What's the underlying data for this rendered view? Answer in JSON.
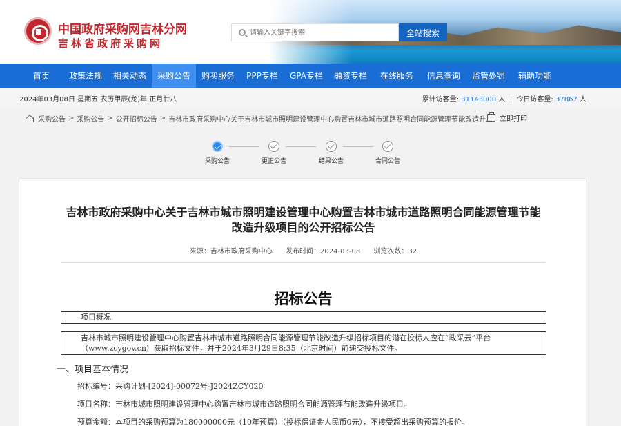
{
  "header": {
    "title": "中国政府采购网吉林分网",
    "subtitle": "吉林省政府采购网",
    "search_placeholder": "请输入关键字搜索",
    "search_button": "全站搜索"
  },
  "nav": [
    {
      "label": "首页",
      "active": false
    },
    {
      "label": "政策法规",
      "active": false
    },
    {
      "label": "相关动态",
      "active": false
    },
    {
      "label": "采购公告",
      "active": true
    },
    {
      "label": "购买服务",
      "active": false
    },
    {
      "label": "PPP专栏",
      "active": false
    },
    {
      "label": "GPA专栏",
      "active": false
    },
    {
      "label": "融资专栏",
      "active": false
    },
    {
      "label": "在线服务",
      "active": false
    },
    {
      "label": "信息查询",
      "active": false
    },
    {
      "label": "监管处罚",
      "active": false
    },
    {
      "label": "辅助功能",
      "active": false
    }
  ],
  "info_bar": {
    "date": "2024年03月08日 星期五 农历甲辰(龙)年 正月廿八",
    "total_visits_label": "累计访客量:",
    "total_visits": "31143000",
    "total_visits_unit": "人",
    "today_visits_label": "今日访客量:",
    "today_visits": "37867",
    "today_visits_unit": "人"
  },
  "breadcrumb": {
    "items": [
      "采购公告",
      "采购公告",
      "公开招标公告",
      "吉林市政府采购中心关于吉林市城市照明建设管理中心购置吉林市城市道路照明合同能源管理节能改造升..."
    ],
    "separator": ">"
  },
  "print_label": "立即打印",
  "steps": [
    {
      "label": "采购公告",
      "done": true
    },
    {
      "label": "更正公告",
      "done": false
    },
    {
      "label": "结果公告",
      "done": false
    },
    {
      "label": "合同公告",
      "done": false
    }
  ],
  "article": {
    "title": "吉林市政府采购中心关于吉林市城市照明建设管理中心购置吉林市城市道路照明合同能源管理节能改造升级项目的公开招标公告",
    "source": "来源：吉林市政府采购中心",
    "publish_time": "发布时间：2024-03-08",
    "views": "浏览次数：32",
    "notice_title": "招标公告",
    "overview_label": "项目概况",
    "overview_text": "吉林市城市照明建设管理中心购置吉林市城市道路照明合同能源管理节能改造升级招标项目的潜在投标人应在“政采云”平台（www.zcygov.cn）获取招标文件，并于2024年3月29日8:35（北京时间）前递交投标文件。",
    "section_1": "一、项目基本情况",
    "field_bid_no": "招标编号：采购计划-[2024]-00072号-J2024ZCY020",
    "field_project_name": "项目名称：吉林市城市照明建设管理中心购置吉林市城市道路照明合同能源管理节能改造升级项目。",
    "field_budget": "预算金额：本项目的采购预算为180000000元（10年预算）（投标保证金人民币0元），不接受超出采购预算的报价。"
  }
}
